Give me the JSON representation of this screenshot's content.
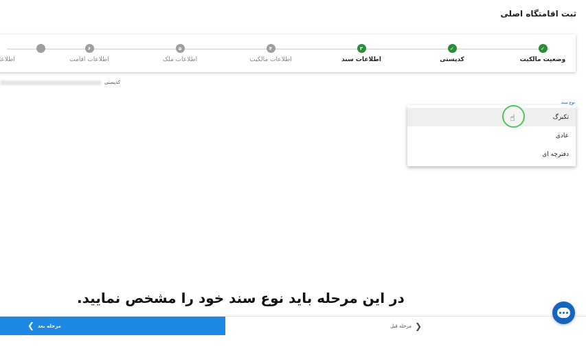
{
  "header": {
    "title": "ثبت اقامتگاه اصلی"
  },
  "stepper": {
    "steps": [
      {
        "label": "وضعیت مالکیت",
        "badge": "✓",
        "state": "done"
      },
      {
        "label": "کدپستی",
        "badge": "✓",
        "state": "done"
      },
      {
        "label": "اطلاعات سند",
        "badge": "۳",
        "state": "current"
      },
      {
        "label": "اطلاعات مالکیت",
        "badge": "۴",
        "state": "todo"
      },
      {
        "label": "اطلاعات ملک",
        "badge": "۵",
        "state": "todo"
      },
      {
        "label": "اطلاعات اقامت",
        "badge": "۶",
        "state": "todo"
      },
      {
        "label": "اطلاعات",
        "badge": "",
        "state": "todo"
      }
    ]
  },
  "postal": {
    "label": "کدپستی"
  },
  "document_type": {
    "label": "نوع سند",
    "options": [
      "تکبرگ",
      "عادی",
      "دفترچه ای"
    ],
    "hovered": "تکبرگ"
  },
  "caption": "در این مرحله باید نوع سند خود را مشخص نمایید.",
  "footer": {
    "next_label": "مرحله بعد",
    "prev_label": "مرحله قبل"
  },
  "icons": {
    "chat": "chat-bubble-icon",
    "cursor": "hand-pointer-icon"
  },
  "colors": {
    "primary": "#1e88e5",
    "success": "#2e8b3a",
    "chat": "#1565c0",
    "ring": "#4cc65a"
  }
}
